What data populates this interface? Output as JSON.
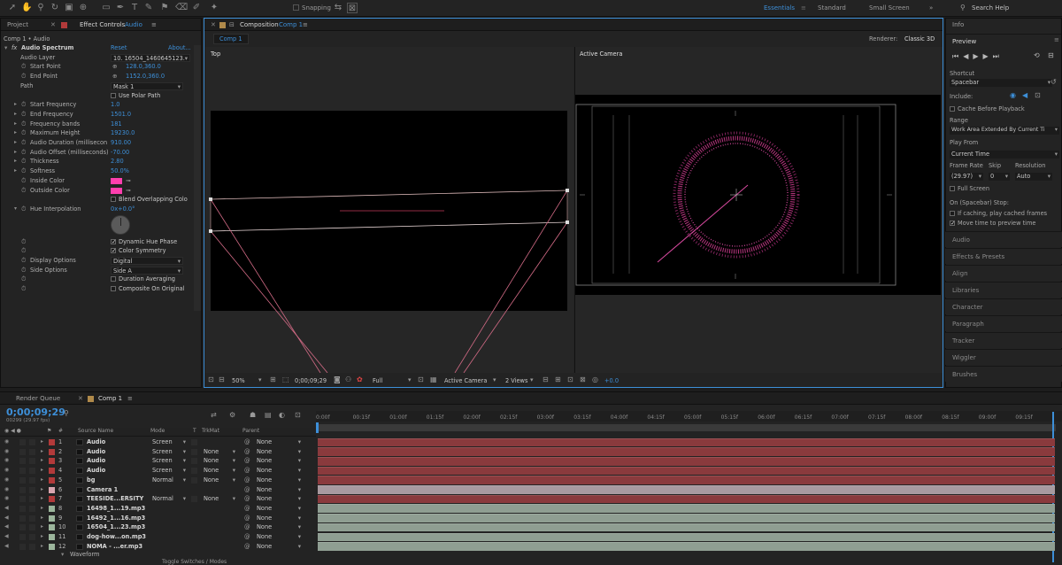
{
  "toolbar": {
    "snapping_label": "Snapping",
    "workspaces": [
      "Essentials",
      "Standard",
      "Small Screen"
    ],
    "search_placeholder": "Search Help"
  },
  "left_tabs": {
    "project": "Project",
    "effect_controls": "Effect Controls",
    "effect_controls_layer": "Audio"
  },
  "effect_controls": {
    "breadcrumb": "Comp 1 • Audio",
    "effect_name": "Audio Spectrum",
    "reset": "Reset",
    "about": "About...",
    "audio_layer_label": "Audio Layer",
    "audio_layer_value": "10. 16504_1460645123.",
    "start_point_label": "Start Point",
    "start_point_value": "128.0,360.0",
    "end_point_label": "End Point",
    "end_point_value": "1152.0,360.0",
    "path_label": "Path",
    "path_value": "Mask 1",
    "use_polar_path": "Use Polar Path",
    "params": [
      {
        "label": "Start Frequency",
        "value": "1.0"
      },
      {
        "label": "End Frequency",
        "value": "1501.0"
      },
      {
        "label": "Frequency bands",
        "value": "181"
      },
      {
        "label": "Maximum Height",
        "value": "19230.0"
      },
      {
        "label": "Audio Duration (millisecon",
        "value": "910.00"
      },
      {
        "label": "Audio Offset (milliseconds)",
        "value": "-70.00"
      },
      {
        "label": "Thickness",
        "value": "2.80"
      },
      {
        "label": "Softness",
        "value": "50.0%"
      }
    ],
    "inside_color_label": "Inside Color",
    "outside_color_label": "Outside Color",
    "blend_label": "Blend Overlapping Colo",
    "hue_label": "Hue Interpolation",
    "hue_value": "0x+0.0°",
    "dynamic_hue": "Dynamic Hue Phase",
    "color_symmetry": "Color Symmetry",
    "display_options_label": "Display Options",
    "display_options_value": "Digital",
    "side_options_label": "Side Options",
    "side_options_value": "Side A",
    "duration_averaging": "Duration Averaging",
    "composite": "Composite On Original",
    "colors": {
      "inside": "#ff3fae",
      "outside": "#ff3fae"
    }
  },
  "composition": {
    "panel_label": "Composition",
    "comp_name": "Comp 1",
    "tab": "Comp 1",
    "renderer_label": "Renderer:",
    "renderer_value": "Classic 3D",
    "view_left": "Top",
    "view_right": "Active Camera",
    "zoom": "50%",
    "timecode": "0;00;09;29",
    "resolution": "Full",
    "camera": "Active Camera",
    "views": "2 Views",
    "exposure": "+0.0"
  },
  "right_panel": {
    "info": "Info",
    "preview": "Preview",
    "shortcut_label": "Shortcut",
    "shortcut_value": "Spacebar",
    "include_label": "Include:",
    "cache_before": "Cache Before Playback",
    "range_label": "Range",
    "range_value": "Work Area Extended By Current Ti",
    "play_from_label": "Play From",
    "play_from_value": "Current Time",
    "frame_rate_label": "Frame Rate",
    "skip_label": "Skip",
    "resolution_label": "Resolution",
    "frame_rate_value": "(29.97)",
    "skip_value": "0",
    "resolution_value": "Auto",
    "full_screen": "Full Screen",
    "stop_label": "On (Spacebar) Stop:",
    "stop_opt1": "If caching, play cached frames",
    "stop_opt2": "Move time to preview time",
    "sections": [
      "Audio",
      "Effects & Presets",
      "Align",
      "Libraries",
      "Character",
      "Paragraph",
      "Tracker",
      "Wiggler",
      "Brushes"
    ]
  },
  "timeline": {
    "render_queue": "Render Queue",
    "comp_tab": "Comp 1",
    "timecode": "0;00;09;29",
    "fps_info": "00299 (29.97 fps)",
    "col_source": "Source Name",
    "col_mode": "Mode",
    "col_t": "T",
    "col_trkmat": "TrkMat",
    "col_parent": "Parent",
    "ruler": [
      "0:00f",
      "00:15f",
      "01:00f",
      "01:15f",
      "02:00f",
      "02:15f",
      "03:00f",
      "03:15f",
      "04:00f",
      "04:15f",
      "05:00f",
      "05:15f",
      "06:00f",
      "06:15f",
      "07:00f",
      "07:15f",
      "08:00f",
      "08:15f",
      "09:00f",
      "09:15f"
    ],
    "layers": [
      {
        "num": "1",
        "name": "Audio",
        "mode": "Screen",
        "trkmat": "",
        "parent": "None",
        "color": "#b23a3a",
        "bar": "#8a3a3d"
      },
      {
        "num": "2",
        "name": "Audio",
        "mode": "Screen",
        "trkmat": "None",
        "parent": "None",
        "color": "#b23a3a",
        "bar": "#8a3a3d"
      },
      {
        "num": "3",
        "name": "Audio",
        "mode": "Screen",
        "trkmat": "None",
        "parent": "None",
        "color": "#b23a3a",
        "bar": "#8a3a3d"
      },
      {
        "num": "4",
        "name": "Audio",
        "mode": "Screen",
        "trkmat": "None",
        "parent": "None",
        "color": "#b23a3a",
        "bar": "#8a3a3d"
      },
      {
        "num": "5",
        "name": "bg",
        "mode": "Normal",
        "trkmat": "None",
        "parent": "None",
        "color": "#b23a3a",
        "bar": "#8a3a3d"
      },
      {
        "num": "6",
        "name": "Camera 1",
        "mode": "",
        "trkmat": "",
        "parent": "None",
        "color": "#d9a6b0",
        "bar": "#a89aa0"
      },
      {
        "num": "7",
        "name": "TEESIDE...ERSITY",
        "mode": "Normal",
        "trkmat": "None",
        "parent": "None",
        "color": "#b23a3a",
        "bar": "#8a3a3d"
      },
      {
        "num": "8",
        "name": "16498_1...19.mp3",
        "mode": "",
        "trkmat": "",
        "parent": "None",
        "color": "#9bb59b",
        "bar": "#8f9e92"
      },
      {
        "num": "9",
        "name": "16492_1...16.mp3",
        "mode": "",
        "trkmat": "",
        "parent": "None",
        "color": "#9bb59b",
        "bar": "#8f9e92"
      },
      {
        "num": "10",
        "name": "16504_1...23.mp3",
        "mode": "",
        "trkmat": "",
        "parent": "None",
        "color": "#9bb59b",
        "bar": "#8f9e92"
      },
      {
        "num": "11",
        "name": "dog-how...on.mp3",
        "mode": "",
        "trkmat": "",
        "parent": "None",
        "color": "#9bb59b",
        "bar": "#8f9e92"
      },
      {
        "num": "12",
        "name": "NOMA - ...er.mp3",
        "mode": "",
        "trkmat": "",
        "parent": "None",
        "color": "#9bb59b",
        "bar": "#8f9e92"
      }
    ],
    "waveform_label": "Waveform",
    "toggle_label": "Toggle Switches / Modes"
  },
  "accent": "#3d8fd8"
}
